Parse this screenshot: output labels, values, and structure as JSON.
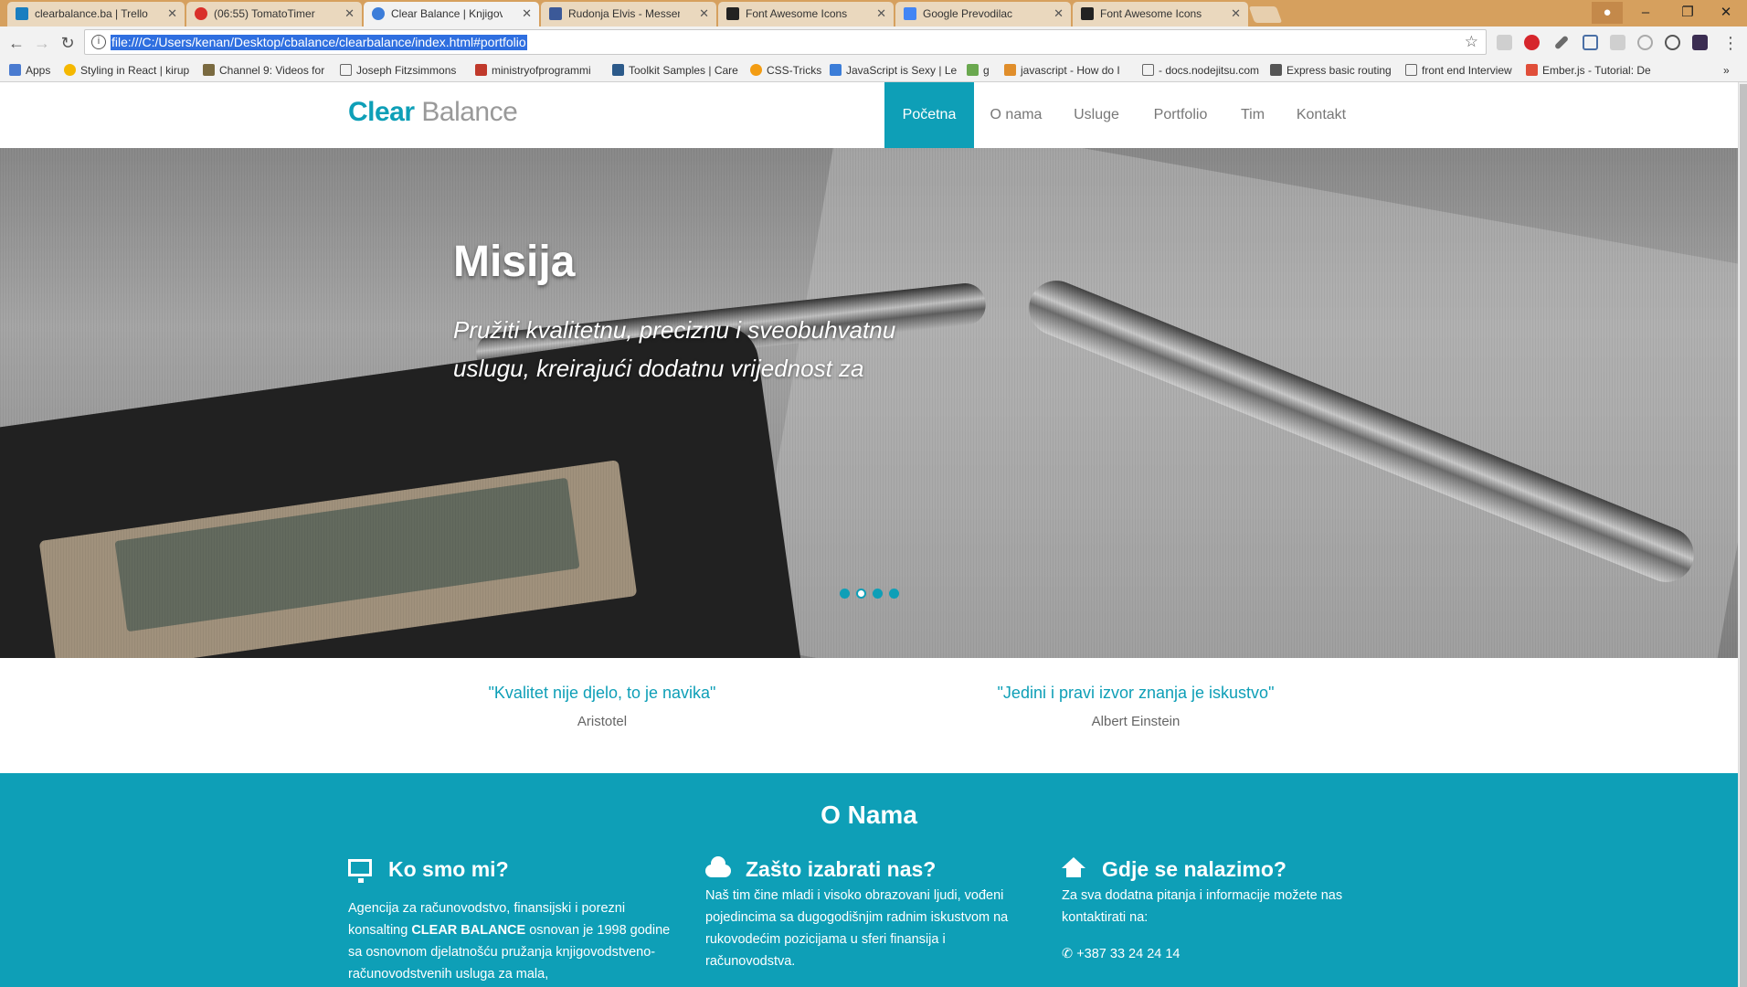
{
  "browser": {
    "tabs": [
      {
        "title": "clearbalance.ba | Trello",
        "favicon_color": "#1a7ec0"
      },
      {
        "title": "(06:55) TomatoTimer",
        "favicon_color": "#d9302a"
      },
      {
        "title": "Clear Balance | Knjigovodstvo",
        "favicon_color": "#3c7dd9"
      },
      {
        "title": "Rudonja Elvis - Messenger",
        "favicon_color": "#3b5998"
      },
      {
        "title": "Font Awesome Icons",
        "favicon_color": "#222222"
      },
      {
        "title": "Google Prevodilac",
        "favicon_color": "#4285f4"
      },
      {
        "title": "Font Awesome Icons",
        "favicon_color": "#222222"
      }
    ],
    "url": "file:///C:/Users/kenan/Desktop/cbalance/clearbalance/index.html#portfolio",
    "bookmarks": [
      "Apps",
      "Styling in React | kirup",
      "Channel 9: Videos for",
      "Joseph Fitzsimmons -",
      "ministryofprogrammi",
      "Toolkit Samples | Care",
      "CSS-Tricks",
      "JavaScript is Sexy | Le",
      "g",
      "javascript - How do I",
      "- docs.nodejitsu.com",
      "Express basic routing",
      "front end Interview",
      "Ember.js - Tutorial: De"
    ]
  },
  "site": {
    "logo": {
      "strong": "Clear",
      "light": "Balance"
    },
    "nav": [
      "Početna",
      "O nama",
      "Usluge",
      "Portfolio",
      "Tim",
      "Kontakt"
    ],
    "hero": {
      "title": "Misija",
      "text": "Pružiti kvalitetnu, preciznu i sveobuhvatnu uslugu, kreirajući dodatnu vrijednost za",
      "slides": 4,
      "active_slide": 2
    },
    "quotes": [
      {
        "text": "\"Kvalitet nije djelo, to je navika\"",
        "author": "Aristotel"
      },
      {
        "text": "\"Jedini i pravi izvor znanja je iskustvo\"",
        "author": "Albert Einstein"
      }
    ],
    "about": {
      "title": "O Nama",
      "columns": [
        {
          "icon": "desktop-icon",
          "heading": "Ko smo mi?",
          "text_pre": "Agencija za računovodstvo, finansijski i porezni konsalting ",
          "text_bold": "CLEAR BALANCE",
          "text_post": " osnovan je 1998 godine sa osnovnom djelatnošću pružanja knjigovodstveno-računovodstvenih usluga za mala,"
        },
        {
          "icon": "cloud-icon",
          "heading": "Zašto izabrati nas?",
          "text": "Naš tim čine mladi i visoko obrazovani ljudi, vođeni pojedincima sa dugogodišnjim radnim iskustvom na rukovodećim pozicijama u sferi finansija i računovodstva."
        },
        {
          "icon": "home-icon",
          "heading": "Gdje se nalazimo?",
          "text": "Za sva dodatna pitanja i informacije možete nas kontaktirati na:",
          "phone": "+387 33 24 24 14"
        }
      ]
    },
    "colors": {
      "accent": "#0e9fb7"
    }
  }
}
